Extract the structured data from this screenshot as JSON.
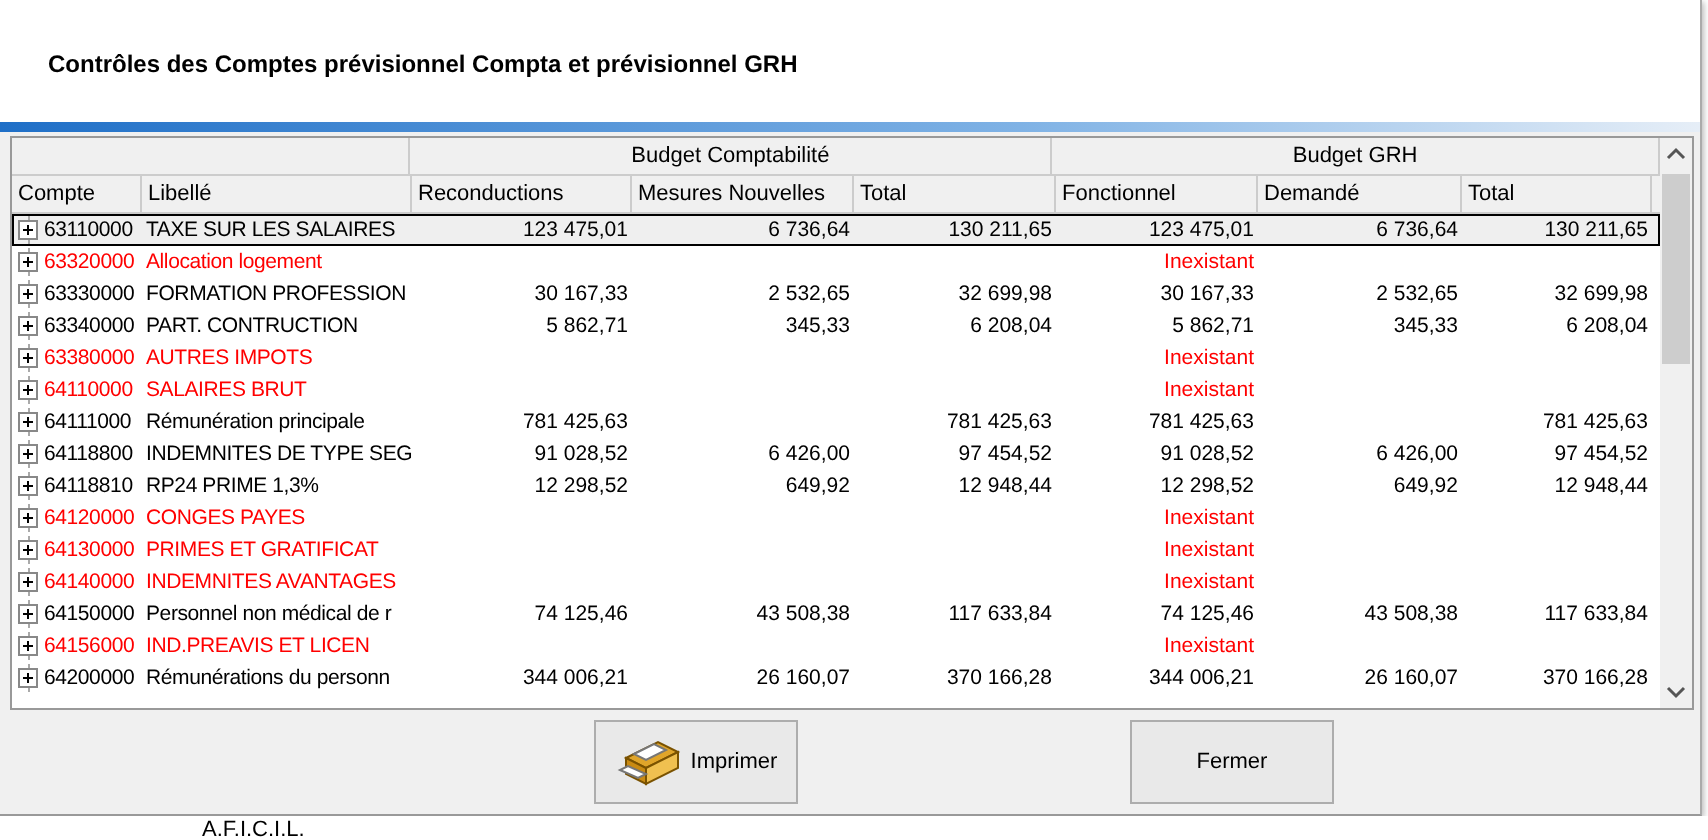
{
  "dialog": {
    "title": "Contrôles des Comptes prévisionnel Compta et prévisionnel GRH"
  },
  "grid": {
    "groups": [
      "Budget Comptabilité",
      "Budget GRH"
    ],
    "columns": [
      "Compte",
      "Libellé",
      "Reconductions",
      "Mesures Nouvelles",
      "Total",
      "Fonctionnel",
      "Demandé",
      "Total"
    ],
    "rows": [
      {
        "compte": "63110000",
        "libelle": "TAXE SUR LES SALAIRES",
        "missing": false,
        "selected": true,
        "reconductions": "123 475,01",
        "mesures": "6 736,64",
        "total_compta": "130 211,65",
        "fonctionnel": "123 475,01",
        "demande": "6 736,64",
        "total_grh": "130 211,65"
      },
      {
        "compte": "63320000",
        "libelle": "Allocation logement",
        "missing": true,
        "selected": false,
        "fonctionnel": "Inexistant"
      },
      {
        "compte": "63330000",
        "libelle": "FORMATION PROFESSION",
        "missing": false,
        "selected": false,
        "reconductions": "30 167,33",
        "mesures": "2 532,65",
        "total_compta": "32 699,98",
        "fonctionnel": "30 167,33",
        "demande": "2 532,65",
        "total_grh": "32 699,98"
      },
      {
        "compte": "63340000",
        "libelle": "PART. CONTRUCTION",
        "missing": false,
        "selected": false,
        "reconductions": "5 862,71",
        "mesures": "345,33",
        "total_compta": "6 208,04",
        "fonctionnel": "5 862,71",
        "demande": "345,33",
        "total_grh": "6 208,04"
      },
      {
        "compte": "63380000",
        "libelle": "AUTRES IMPOTS",
        "missing": true,
        "selected": false,
        "fonctionnel": "Inexistant"
      },
      {
        "compte": "64110000",
        "libelle": "SALAIRES BRUT",
        "missing": true,
        "selected": false,
        "fonctionnel": "Inexistant"
      },
      {
        "compte": "64111000",
        "libelle": "Rémunération principale",
        "missing": false,
        "selected": false,
        "reconductions": "781 425,63",
        "total_compta": "781 425,63",
        "fonctionnel": "781 425,63",
        "total_grh": "781 425,63"
      },
      {
        "compte": "64118800",
        "libelle": "INDEMNITES DE TYPE SEG",
        "missing": false,
        "selected": false,
        "reconductions": "91 028,52",
        "mesures": "6 426,00",
        "total_compta": "97 454,52",
        "fonctionnel": "91 028,52",
        "demande": "6 426,00",
        "total_grh": "97 454,52"
      },
      {
        "compte": "64118810",
        "libelle": "RP24 PRIME 1,3%",
        "missing": false,
        "selected": false,
        "reconductions": "12 298,52",
        "mesures": "649,92",
        "total_compta": "12 948,44",
        "fonctionnel": "12 298,52",
        "demande": "649,92",
        "total_grh": "12 948,44"
      },
      {
        "compte": "64120000",
        "libelle": "CONGES PAYES",
        "missing": true,
        "selected": false,
        "fonctionnel": "Inexistant"
      },
      {
        "compte": "64130000",
        "libelle": "PRIMES ET GRATIFICAT",
        "missing": true,
        "selected": false,
        "fonctionnel": "Inexistant"
      },
      {
        "compte": "64140000",
        "libelle": "INDEMNITES AVANTAGES",
        "missing": true,
        "selected": false,
        "fonctionnel": "Inexistant"
      },
      {
        "compte": "64150000",
        "libelle": "Personnel non médical de r",
        "missing": false,
        "selected": false,
        "reconductions": "74 125,46",
        "mesures": "43 508,38",
        "total_compta": "117 633,84",
        "fonctionnel": "74 125,46",
        "demande": "43 508,38",
        "total_grh": "117 633,84"
      },
      {
        "compte": "64156000",
        "libelle": "IND.PREAVIS ET LICEN",
        "missing": true,
        "selected": false,
        "fonctionnel": "Inexistant"
      },
      {
        "compte": "64200000",
        "libelle": "Rémunérations du personn",
        "missing": false,
        "selected": false,
        "reconductions": "344 006,21",
        "mesures": "26 160,07",
        "total_compta": "370 166,28",
        "fonctionnel": "344 006,21",
        "demande": "26 160,07",
        "total_grh": "370 166,28"
      }
    ]
  },
  "buttons": [
    {
      "kind": "print",
      "label": "Imprimer"
    },
    {
      "kind": "plain",
      "label": "Fermer"
    }
  ],
  "background_text": "A.F.I.C.I.L."
}
